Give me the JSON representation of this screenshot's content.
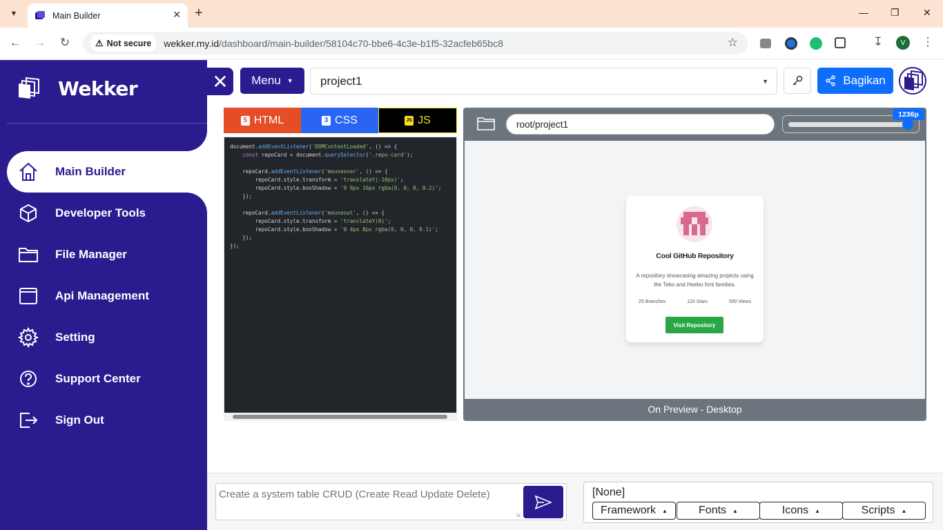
{
  "browser": {
    "tab_title": "Main Builder",
    "url_host": "wekker.my.id",
    "url_path": "/dashboard/main-builder/58104c70-bbe6-4c3e-b1f5-32acfeb65bc8",
    "not_secure_label": "Not secure",
    "profile_initial": "V"
  },
  "sidebar": {
    "brand": "Wekker",
    "items": [
      {
        "label": "Main Builder",
        "icon": "home-icon"
      },
      {
        "label": "Developer Tools",
        "icon": "cube-icon"
      },
      {
        "label": "File Manager",
        "icon": "folder-icon"
      },
      {
        "label": "Api Management",
        "icon": "window-icon"
      },
      {
        "label": "Setting",
        "icon": "gear-icon"
      },
      {
        "label": "Support Center",
        "icon": "help-circle-icon"
      },
      {
        "label": "Sign Out",
        "icon": "sign-out-icon"
      }
    ]
  },
  "toolbar": {
    "menu_label": "Menu",
    "project_selected": "project1",
    "share_label": "Bagikan"
  },
  "editor": {
    "tabs": [
      {
        "label": "HTML",
        "color": "#e44d26"
      },
      {
        "label": "CSS",
        "color": "#2965f1"
      },
      {
        "label": "JS",
        "color": "#000000"
      }
    ],
    "active_tab": "JS",
    "code_lines": [
      "document.addEventListener('DOMContentLoaded', () => {",
      "    const repoCard = document.querySelector('.repo-card');",
      "",
      "    repoCard.addEventListener('mouseover', () => {",
      "        repoCard.style.transform = 'translateY(-10px)';",
      "        repoCard.style.boxShadow = '0 8px 16px rgba(0, 0, 0, 0.2)';",
      "    });",
      "",
      "    repoCard.addEventListener('mouseout', () => {",
      "        repoCard.style.transform = 'translateY(0)';",
      "        repoCard.style.boxShadow = '0 4px 8px rgba(0, 0, 0, 0.1)';",
      "    });",
      "});"
    ]
  },
  "preview": {
    "path": "root/project1",
    "width_badge": "1236p",
    "slider_fraction": 0.97,
    "footer": "On Preview - Desktop",
    "card": {
      "title": "Cool GitHub Repository",
      "description": "A repository showcasing amazing projects using the Teko and Heebo font families.",
      "stats": [
        "25 Branches",
        "120 Stars",
        "500 Views"
      ],
      "button": "Visit Repository"
    }
  },
  "bottom": {
    "prompt_placeholder": "Create a system table CRUD (Create Read Update Delete)",
    "addon_selected": "[None]",
    "addon_buttons": [
      "Framework",
      "Fonts",
      "Icons",
      "Scripts"
    ]
  },
  "colors": {
    "brand": "#2a1b8f",
    "primary": "#0d6efd",
    "success": "#28a745"
  }
}
